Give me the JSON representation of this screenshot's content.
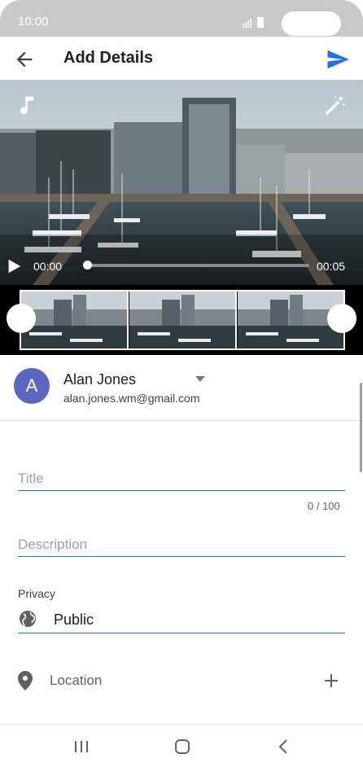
{
  "status_bar": {
    "time": "10:00"
  },
  "app_bar": {
    "title": "Add Details",
    "back_icon": "arrow-back-icon",
    "send_icon": "send-icon",
    "accent": "#1a73e8"
  },
  "video": {
    "current_time": "00:00",
    "duration": "00:05",
    "progress": 0,
    "music_icon": "music-note-icon",
    "filter_icon": "magic-wand-icon"
  },
  "account": {
    "initial": "A",
    "name": "Alan Jones",
    "email": "alan.jones.wm@gmail.com",
    "avatar_color": "#5b66c1"
  },
  "form": {
    "title_placeholder": "Title",
    "title_counter": "0 / 100",
    "description_placeholder": "Description",
    "privacy_label": "Privacy",
    "privacy_value": "Public",
    "location_label": "Location"
  },
  "nav": {
    "recent_icon": "recent-apps-icon",
    "home_icon": "home-icon",
    "back_icon": "nav-back-icon"
  }
}
